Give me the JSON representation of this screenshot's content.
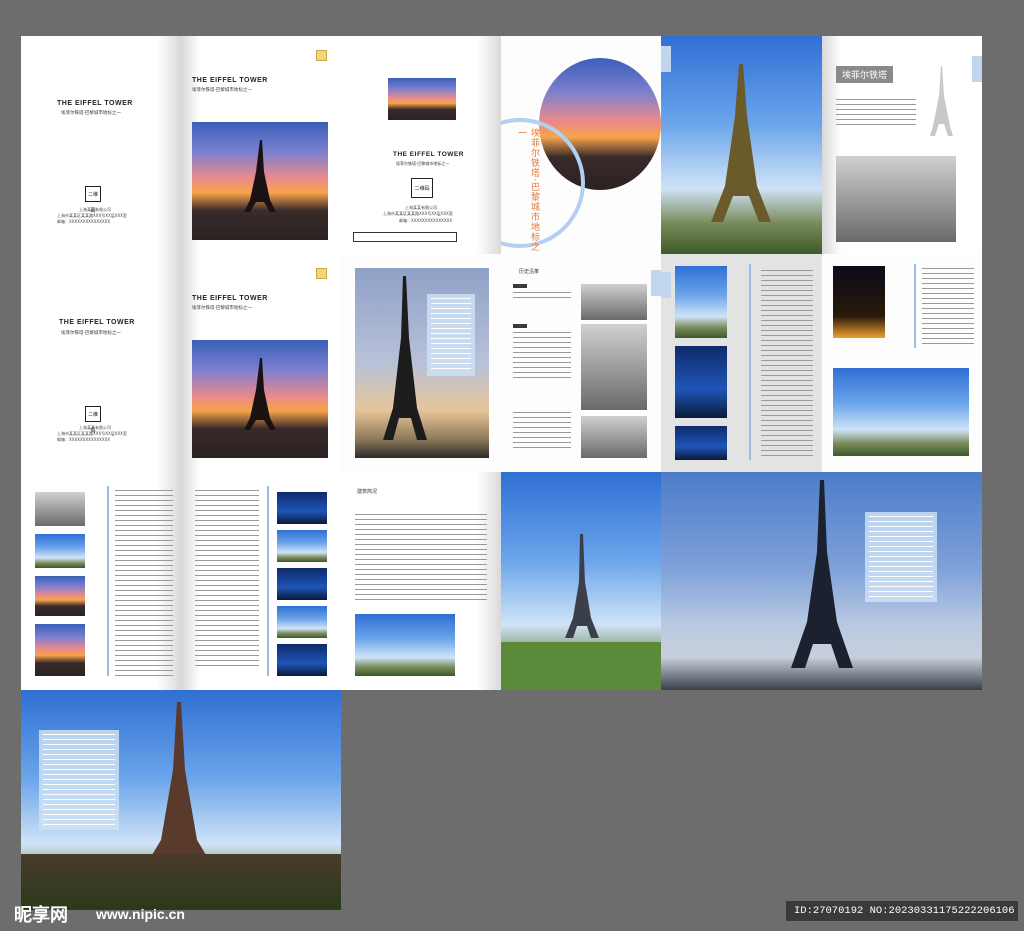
{
  "brochure": {
    "title_en": "THE EIFFEL TOWER",
    "subtitle_cn": "埃菲尔铁塔·巴黎城市地标之一",
    "qr_label": "二维码",
    "company": "上海某某有限公司",
    "address": "上海市某某区某某路XXX号XX层XXX室",
    "email": "邮箱：XXXXXXXXXXXXXXX",
    "section_title_cn": "埃菲尔铁塔",
    "vertical_slogan": "埃菲尔铁塔·巴黎城市地标之一",
    "history_title": "历史沿革",
    "arch_title": "建筑简况",
    "timeline_years": [
      "1884年",
      "1886年",
      "1887年",
      "1889年",
      "1900年",
      "1910年",
      "1925年",
      "1937年",
      "1957年",
      "1986年",
      "1991年",
      "2003年"
    ]
  },
  "watermark": {
    "logo": "昵享网",
    "url": "www.nipic.cn",
    "id": "ID:27070192 NO:20230331175222206106"
  }
}
